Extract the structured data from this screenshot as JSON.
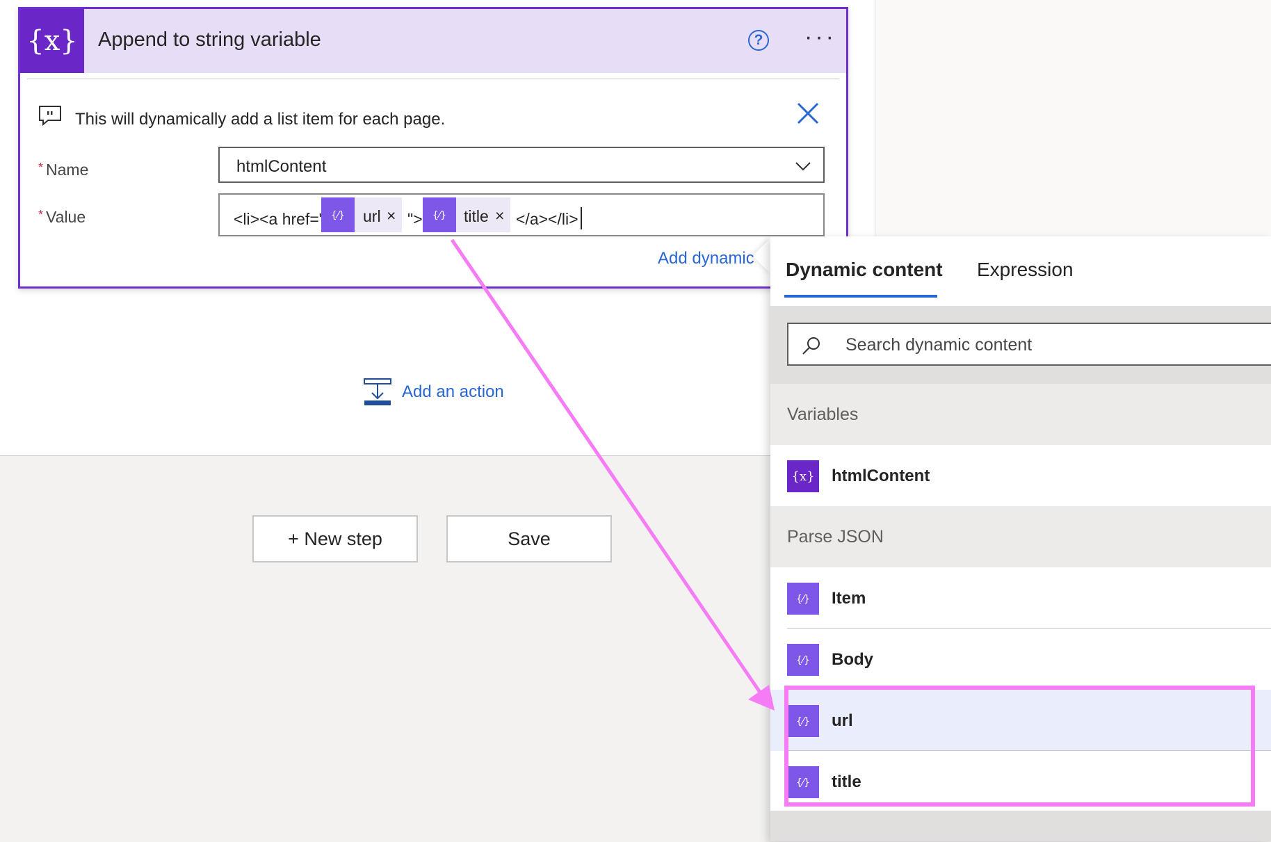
{
  "action_card": {
    "title": "Append to string variable",
    "help_icon_glyph": "?",
    "more_glyph": "···",
    "icon_glyph": "{x}",
    "comment": "This will dynamically add a list item for each page.",
    "name_label": "Name",
    "name_value": "htmlContent",
    "value_label": "Value",
    "required_marker": "*",
    "value_parts": {
      "prefix": "<li><a href=\"",
      "token1": "url",
      "middle": "\">",
      "token2": "title",
      "suffix": "</a></li>"
    },
    "token_remove_glyph": "×",
    "add_dynamic_label": "Add dynamic con"
  },
  "canvas": {
    "add_action_label": "Add an action",
    "new_step_label": "+ New step",
    "save_label": "Save"
  },
  "dynamic_panel": {
    "tabs": [
      "Dynamic content",
      "Expression"
    ],
    "active_tab": "Dynamic content",
    "search_placeholder": "Search dynamic content",
    "sections": [
      {
        "title": "Variables",
        "items": [
          {
            "label": "htmlContent",
            "icon": "variable-icon"
          }
        ]
      },
      {
        "title": "Parse JSON",
        "items": [
          {
            "label": "Item",
            "icon": "parse-json-icon"
          },
          {
            "label": "Body",
            "icon": "parse-json-icon"
          },
          {
            "label": "url",
            "icon": "parse-json-icon"
          },
          {
            "label": "title",
            "icon": "parse-json-icon"
          }
        ]
      }
    ]
  },
  "colors": {
    "accent_purple": "#6b26c7",
    "token_purple": "#7e57e8",
    "link_blue": "#2866d6",
    "highlight_pink": "#f57cf5"
  }
}
